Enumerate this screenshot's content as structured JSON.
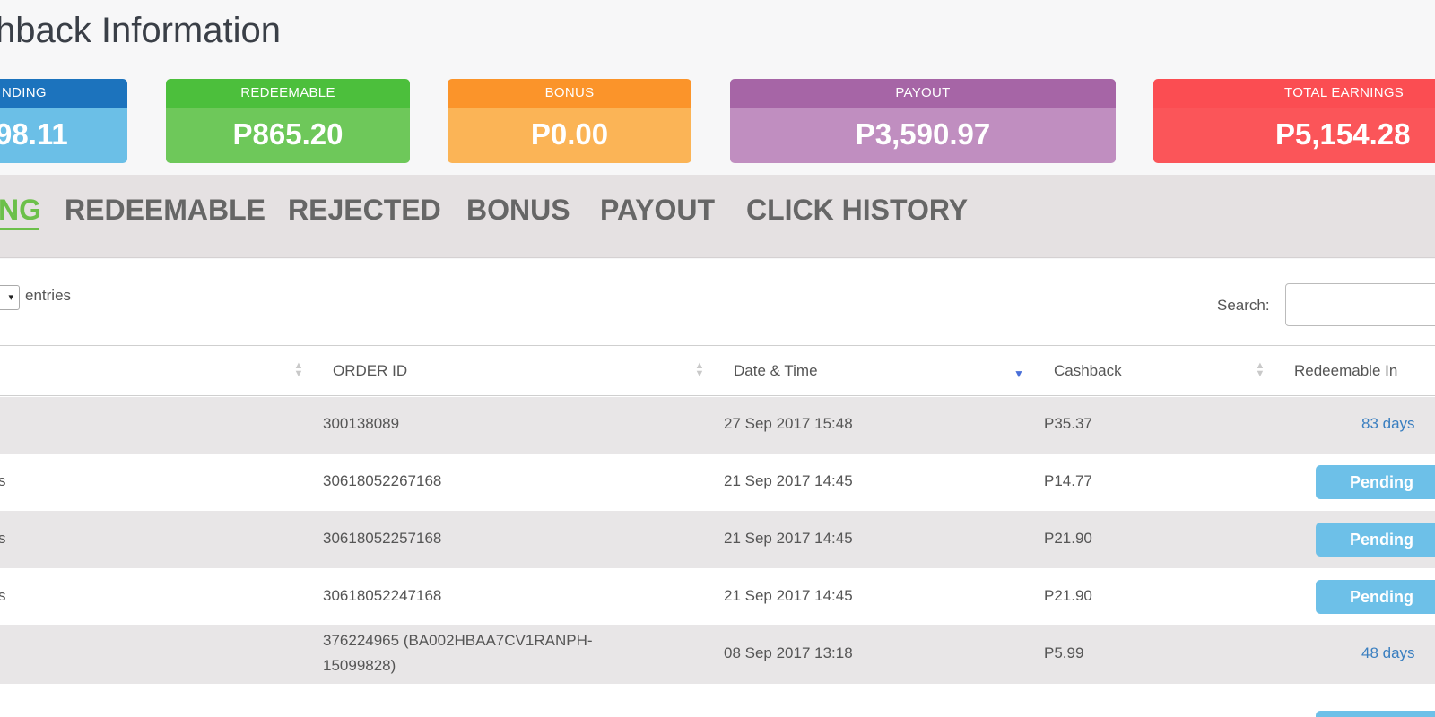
{
  "page": {
    "title": "shback Information"
  },
  "cards": {
    "pending": {
      "label": "NDING",
      "value": "98.11",
      "head_color": "#1c73bd",
      "body_color": "#6bbfe7"
    },
    "redeemable": {
      "label": "REDEEMABLE",
      "value": "P865.20",
      "head_color": "#4cbf3c",
      "body_color": "#6ec85a"
    },
    "bonus": {
      "label": "BONUS",
      "value": "P0.00",
      "head_color": "#fb942a",
      "body_color": "#fbb456"
    },
    "payout": {
      "label": "PAYOUT",
      "value": "P3,590.97",
      "head_color": "#a665a6",
      "body_color": "#c08ec0"
    },
    "total": {
      "label": "TOTAL EARNINGS",
      "value": "P5,154.28",
      "head_color": "#fb4d52",
      "body_color": "#fb5559"
    }
  },
  "tabs": [
    {
      "label": "NG",
      "active": true
    },
    {
      "label": "REDEEMABLE",
      "active": false
    },
    {
      "label": "REJECTED",
      "active": false
    },
    {
      "label": "BONUS",
      "active": false
    },
    {
      "label": "PAYOUT",
      "active": false
    },
    {
      "label": "CLICK HISTORY",
      "active": false
    }
  ],
  "controls": {
    "length_select_value": "▾",
    "length_label": "entries",
    "search_label": "Search:",
    "search_value": ""
  },
  "table": {
    "columns": [
      "ORDER ID",
      "Date & Time",
      "Cashback",
      "Redeemable In"
    ],
    "columns_visible": [
      "ORDER ID",
      "Date & Time",
      "Cashback",
      "Redeemable In"
    ],
    "rows": [
      {
        "store": "",
        "order_id": "300138089",
        "datetime": "27 Sep 2017 15:48",
        "cashback": "P35.37",
        "redeemable": "83 days",
        "redeemable_type": "link"
      },
      {
        "store": "s",
        "order_id": "30618052267168",
        "datetime": "21 Sep 2017 14:45",
        "cashback": "P14.77",
        "redeemable": "Pending",
        "redeemable_type": "pill"
      },
      {
        "store": "s",
        "order_id": "30618052257168",
        "datetime": "21 Sep 2017 14:45",
        "cashback": "P21.90",
        "redeemable": "Pending",
        "redeemable_type": "pill"
      },
      {
        "store": "s",
        "order_id": "30618052247168",
        "datetime": "21 Sep 2017 14:45",
        "cashback": "P21.90",
        "redeemable": "Pending",
        "redeemable_type": "pill"
      },
      {
        "store": "",
        "order_id": "376224965 (BA002HBAA7CV1RANPH-15099828)",
        "datetime": "08 Sep 2017 13:18",
        "cashback": "P5.99",
        "redeemable": "48 days",
        "redeemable_type": "link"
      }
    ]
  }
}
